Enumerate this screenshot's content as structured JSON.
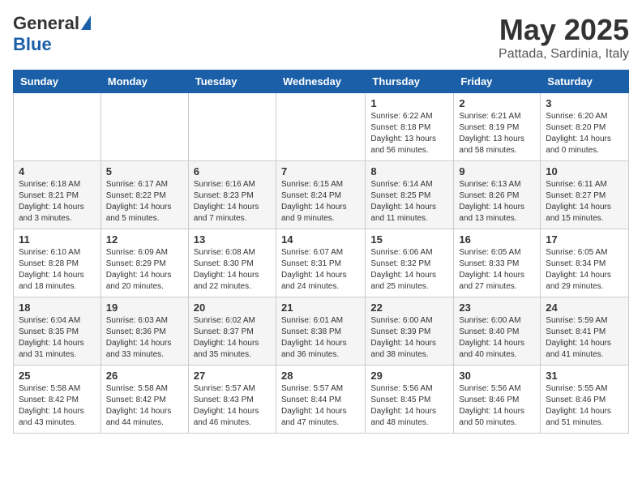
{
  "header": {
    "logo_general": "General",
    "logo_blue": "Blue",
    "month_year": "May 2025",
    "location": "Pattada, Sardinia, Italy"
  },
  "weekdays": [
    "Sunday",
    "Monday",
    "Tuesday",
    "Wednesday",
    "Thursday",
    "Friday",
    "Saturday"
  ],
  "weeks": [
    [
      {
        "day": "",
        "info": ""
      },
      {
        "day": "",
        "info": ""
      },
      {
        "day": "",
        "info": ""
      },
      {
        "day": "",
        "info": ""
      },
      {
        "day": "1",
        "info": "Sunrise: 6:22 AM\nSunset: 8:18 PM\nDaylight: 13 hours\nand 56 minutes."
      },
      {
        "day": "2",
        "info": "Sunrise: 6:21 AM\nSunset: 8:19 PM\nDaylight: 13 hours\nand 58 minutes."
      },
      {
        "day": "3",
        "info": "Sunrise: 6:20 AM\nSunset: 8:20 PM\nDaylight: 14 hours\nand 0 minutes."
      }
    ],
    [
      {
        "day": "4",
        "info": "Sunrise: 6:18 AM\nSunset: 8:21 PM\nDaylight: 14 hours\nand 3 minutes."
      },
      {
        "day": "5",
        "info": "Sunrise: 6:17 AM\nSunset: 8:22 PM\nDaylight: 14 hours\nand 5 minutes."
      },
      {
        "day": "6",
        "info": "Sunrise: 6:16 AM\nSunset: 8:23 PM\nDaylight: 14 hours\nand 7 minutes."
      },
      {
        "day": "7",
        "info": "Sunrise: 6:15 AM\nSunset: 8:24 PM\nDaylight: 14 hours\nand 9 minutes."
      },
      {
        "day": "8",
        "info": "Sunrise: 6:14 AM\nSunset: 8:25 PM\nDaylight: 14 hours\nand 11 minutes."
      },
      {
        "day": "9",
        "info": "Sunrise: 6:13 AM\nSunset: 8:26 PM\nDaylight: 14 hours\nand 13 minutes."
      },
      {
        "day": "10",
        "info": "Sunrise: 6:11 AM\nSunset: 8:27 PM\nDaylight: 14 hours\nand 15 minutes."
      }
    ],
    [
      {
        "day": "11",
        "info": "Sunrise: 6:10 AM\nSunset: 8:28 PM\nDaylight: 14 hours\nand 18 minutes."
      },
      {
        "day": "12",
        "info": "Sunrise: 6:09 AM\nSunset: 8:29 PM\nDaylight: 14 hours\nand 20 minutes."
      },
      {
        "day": "13",
        "info": "Sunrise: 6:08 AM\nSunset: 8:30 PM\nDaylight: 14 hours\nand 22 minutes."
      },
      {
        "day": "14",
        "info": "Sunrise: 6:07 AM\nSunset: 8:31 PM\nDaylight: 14 hours\nand 24 minutes."
      },
      {
        "day": "15",
        "info": "Sunrise: 6:06 AM\nSunset: 8:32 PM\nDaylight: 14 hours\nand 25 minutes."
      },
      {
        "day": "16",
        "info": "Sunrise: 6:05 AM\nSunset: 8:33 PM\nDaylight: 14 hours\nand 27 minutes."
      },
      {
        "day": "17",
        "info": "Sunrise: 6:05 AM\nSunset: 8:34 PM\nDaylight: 14 hours\nand 29 minutes."
      }
    ],
    [
      {
        "day": "18",
        "info": "Sunrise: 6:04 AM\nSunset: 8:35 PM\nDaylight: 14 hours\nand 31 minutes."
      },
      {
        "day": "19",
        "info": "Sunrise: 6:03 AM\nSunset: 8:36 PM\nDaylight: 14 hours\nand 33 minutes."
      },
      {
        "day": "20",
        "info": "Sunrise: 6:02 AM\nSunset: 8:37 PM\nDaylight: 14 hours\nand 35 minutes."
      },
      {
        "day": "21",
        "info": "Sunrise: 6:01 AM\nSunset: 8:38 PM\nDaylight: 14 hours\nand 36 minutes."
      },
      {
        "day": "22",
        "info": "Sunrise: 6:00 AM\nSunset: 8:39 PM\nDaylight: 14 hours\nand 38 minutes."
      },
      {
        "day": "23",
        "info": "Sunrise: 6:00 AM\nSunset: 8:40 PM\nDaylight: 14 hours\nand 40 minutes."
      },
      {
        "day": "24",
        "info": "Sunrise: 5:59 AM\nSunset: 8:41 PM\nDaylight: 14 hours\nand 41 minutes."
      }
    ],
    [
      {
        "day": "25",
        "info": "Sunrise: 5:58 AM\nSunset: 8:42 PM\nDaylight: 14 hours\nand 43 minutes."
      },
      {
        "day": "26",
        "info": "Sunrise: 5:58 AM\nSunset: 8:42 PM\nDaylight: 14 hours\nand 44 minutes."
      },
      {
        "day": "27",
        "info": "Sunrise: 5:57 AM\nSunset: 8:43 PM\nDaylight: 14 hours\nand 46 minutes."
      },
      {
        "day": "28",
        "info": "Sunrise: 5:57 AM\nSunset: 8:44 PM\nDaylight: 14 hours\nand 47 minutes."
      },
      {
        "day": "29",
        "info": "Sunrise: 5:56 AM\nSunset: 8:45 PM\nDaylight: 14 hours\nand 48 minutes."
      },
      {
        "day": "30",
        "info": "Sunrise: 5:56 AM\nSunset: 8:46 PM\nDaylight: 14 hours\nand 50 minutes."
      },
      {
        "day": "31",
        "info": "Sunrise: 5:55 AM\nSunset: 8:46 PM\nDaylight: 14 hours\nand 51 minutes."
      }
    ]
  ]
}
